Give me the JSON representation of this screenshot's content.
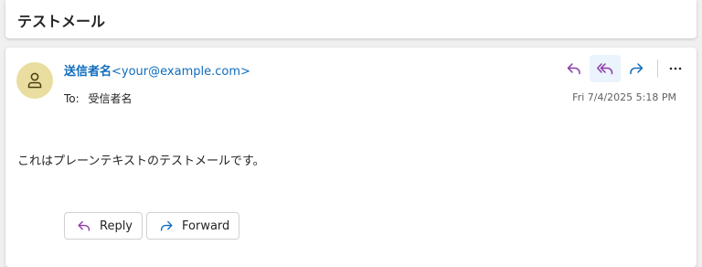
{
  "subject": "テストメール",
  "message": {
    "sender_name": "送信者名",
    "sender_email": "<your@example.com>",
    "to_label": "To:",
    "to_value": "受信者名",
    "date": "Fri 7/4/2025 5:18 PM",
    "body": "これはプレーンテキストのテストメールです。"
  },
  "actions": {
    "reply_label": "Reply",
    "forward_label": "Forward"
  },
  "icons": {
    "reply": "reply-icon",
    "reply_all": "reply-all-icon",
    "forward": "forward-icon",
    "more": "more-icon",
    "avatar": "person-icon"
  },
  "colors": {
    "accent_blue": "#0f6cbd",
    "reply_purple": "#8a3aa8",
    "avatar_bg": "#e9dea0"
  }
}
